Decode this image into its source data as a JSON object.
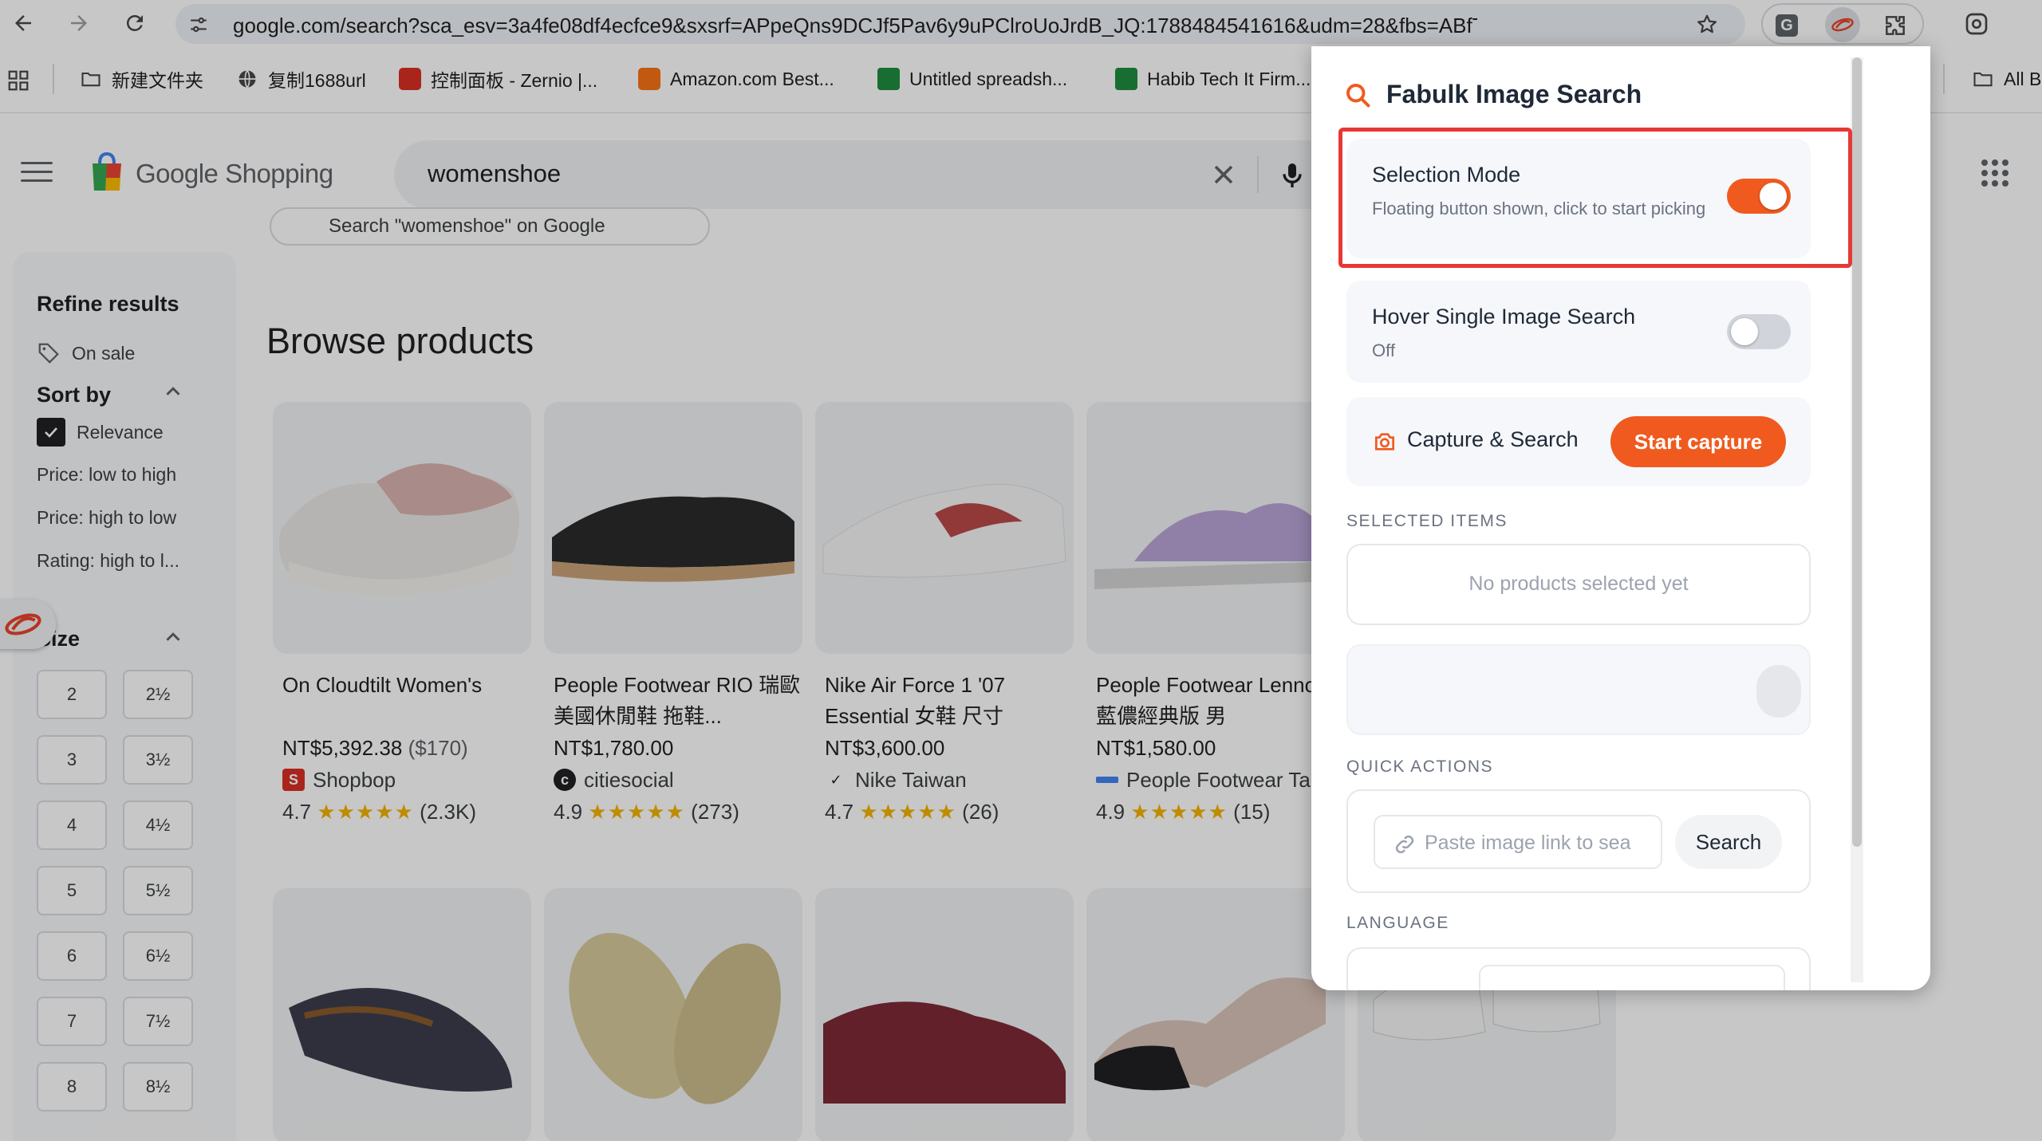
{
  "browser": {
    "url": "google.com/search?sca_esv=3a4fe08df4ecfce9&sxsrf=APpeQns9DCJf5Pav6y9uPClroUoJrdB_JQ:1788484541616&udm=28&fbs=ABfTbF...",
    "extension_g_letter": "G",
    "bookmarks": [
      {
        "label": "新建文件夹",
        "icon": "folder-icon"
      },
      {
        "label": "复制1688url",
        "icon": "globe-icon"
      },
      {
        "label": "控制面板 - Zernio |...",
        "icon": "zernio-icon"
      },
      {
        "label": "Amazon.com Best...",
        "icon": "amazon-icon"
      },
      {
        "label": "Untitled spreadsh...",
        "icon": "sheets-icon"
      },
      {
        "label": "Habib Tech It Firm...",
        "icon": "sheets-icon"
      },
      {
        "label": "All B",
        "icon": "folder-icon"
      }
    ]
  },
  "google": {
    "logo_text": "Google Shopping",
    "search_query": "womenshoe",
    "search_chip": "Search \"womenshoe\" on Google",
    "browse_title": "Browse products",
    "sidebar": {
      "refine_title": "Refine results",
      "on_sale": "On sale",
      "sort_by_title": "Sort by",
      "sort_options": [
        "Relevance",
        "Price: low to high",
        "Price: high to low",
        "Rating: high to l..."
      ],
      "size_title": "Size",
      "sizes": [
        "2",
        "2½",
        "3",
        "3½",
        "4",
        "4½",
        "5",
        "5½",
        "6",
        "6½",
        "7",
        "7½",
        "8",
        "8½"
      ]
    },
    "products": [
      {
        "title": "On Cloudtilt Women's",
        "price": "NT$5,392.38",
        "orig_price": "($170)",
        "store": "Shopbop",
        "rating": "4.7",
        "stars": "★★★★★",
        "reviews": "(2.3K)"
      },
      {
        "title": "People Footwear RIO 瑞歐 美國休閒鞋 拖鞋...",
        "price": "NT$1,780.00",
        "orig_price": "",
        "store": "citiesocial",
        "rating": "4.9",
        "stars": "★★★★★",
        "reviews": "(273)"
      },
      {
        "title": "Nike Air Force 1 '07 Essential 女鞋 尺寸",
        "price": "NT$3,600.00",
        "orig_price": "",
        "store": "Nike Taiwan",
        "rating": "4.7",
        "stars": "★★★★★",
        "reviews": "(26)"
      },
      {
        "title": "People Footwear Lennon 藍儂經典版 男",
        "price": "NT$1,580.00",
        "orig_price": "",
        "store": "People Footwear Ta",
        "rating": "4.9",
        "stars": "★★★★★",
        "reviews": "(15)"
      }
    ]
  },
  "popup": {
    "title": "Fabulk Image Search",
    "selection_mode": {
      "title": "Selection Mode",
      "subtitle": "Floating button shown, click to start picking",
      "on": true
    },
    "hover_search": {
      "title": "Hover Single Image Search",
      "subtitle": "Off",
      "on": false
    },
    "capture": {
      "title": "Capture & Search",
      "button": "Start capture"
    },
    "selected_items": {
      "label": "SELECTED ITEMS",
      "empty": "No products selected yet"
    },
    "quick_actions": {
      "label": "QUICK ACTIONS",
      "placeholder": "Paste image link to sea",
      "button": "Search"
    },
    "language": {
      "label": "LANGUAGE"
    },
    "colors": {
      "accent": "#f05a1f",
      "highlight": "#e53935",
      "toggle_off": "#d1d5db"
    }
  }
}
